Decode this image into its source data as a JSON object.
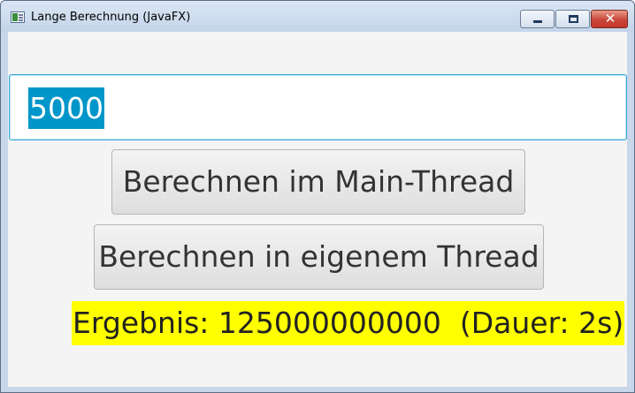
{
  "window": {
    "title": "Lange Berechnung (JavaFX)",
    "controls": {
      "minimize": "minimize-icon",
      "maximize": "maximize-icon",
      "close": "close-icon"
    }
  },
  "form": {
    "number_input": {
      "value": "5000"
    },
    "buttons": {
      "main_thread": "Berechnen im Main-Thread",
      "own_thread": "Berechnen in eigenem Thread"
    },
    "result": "Ergebnis: 125000000000  (Dauer: 2s)"
  },
  "colors": {
    "selection": "#0096c9",
    "result_highlight": "#ffff00",
    "focus_border": "#3ba7d6"
  }
}
